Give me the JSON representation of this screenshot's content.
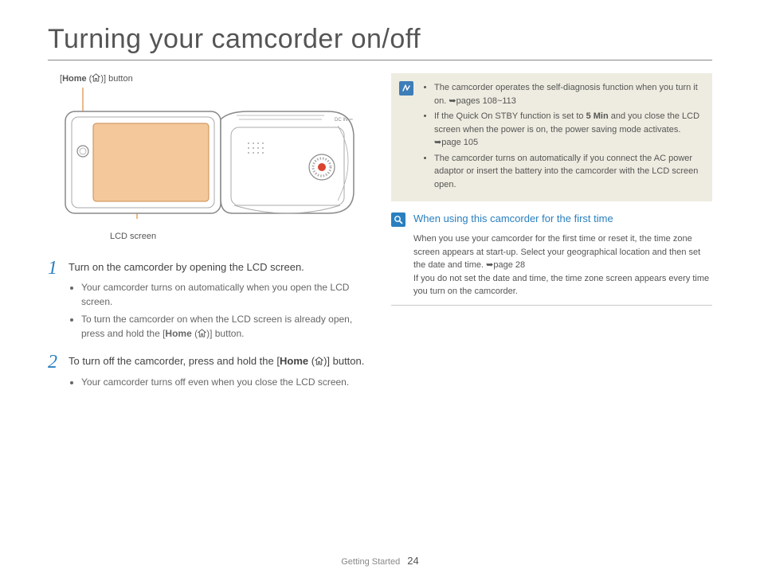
{
  "title": "Turning your camcorder on/off",
  "diagram": {
    "home_button_label_pre": "[",
    "home_button_label_bold": "Home",
    "home_button_label_post": " (",
    "home_button_label_end": ")] button",
    "lcd_label": "LCD screen"
  },
  "steps": [
    {
      "num": "1",
      "text": "Turn on the camcorder by opening the LCD screen.",
      "bullets": [
        "Your camcorder turns on automatically when you open the LCD screen.",
        {
          "pre": "To turn the camcorder on when the LCD screen is already open, press and hold the [",
          "bold": "Home",
          "mid": " (",
          "post": ")] button."
        }
      ]
    },
    {
      "num": "2",
      "text_pre": "To turn off the camcorder, press and hold the [",
      "text_bold": "Home",
      "text_mid": " (",
      "text_post": ")] button.",
      "bullets": [
        "Your camcorder turns off even when you close the LCD screen."
      ]
    }
  ],
  "note_box": {
    "icon_label": "note-icon",
    "bullets": [
      {
        "pre": "The camcorder operates the self-diagnosis function when you turn it on. ",
        "arrow": "➥",
        "post": "pages 108~113"
      },
      {
        "pre": "If the Quick On STBY function is set to ",
        "bold": "5 Min",
        "mid": " and you close the LCD screen when the power is on, the power saving mode activates. ",
        "arrow": "➥",
        "post": "page 105"
      },
      {
        "text": "The camcorder turns on automatically if you connect the AC power adaptor or insert the battery into the camcorder with the LCD screen open."
      }
    ]
  },
  "first_time": {
    "heading": "When using this camcorder for the first time",
    "para1_pre": "When you use your camcorder for the first time or reset it, the time zone screen appears at start-up. Select your geographical location and then set the date and time. ",
    "para1_arrow": "➥",
    "para1_post": "page 28",
    "para2": "If you do not set the date and time, the time zone screen appears every time you turn on the camcorder."
  },
  "footer": {
    "section": "Getting Started",
    "page": "24"
  }
}
